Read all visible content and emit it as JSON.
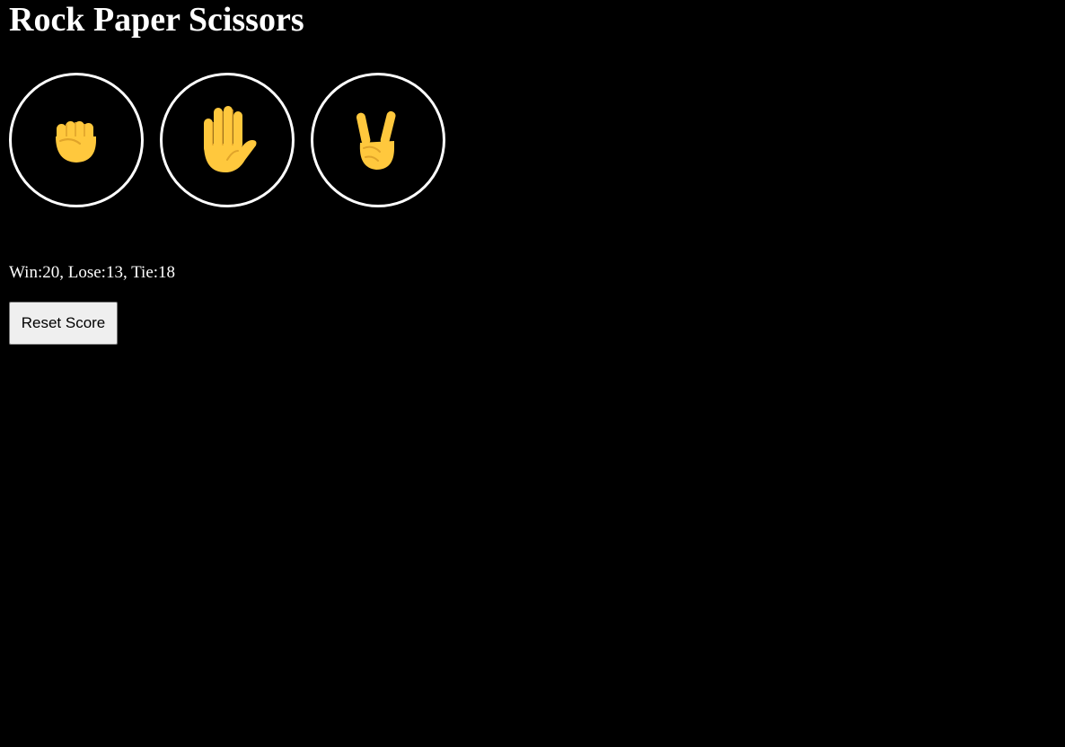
{
  "title": "Rock Paper Scissors",
  "choices": [
    {
      "name": "rock",
      "icon": "raised-fist-icon"
    },
    {
      "name": "paper",
      "icon": "raised-hand-icon"
    },
    {
      "name": "scissors",
      "icon": "victory-hand-icon"
    }
  ],
  "score": {
    "text": "Win:20, Lose:13, Tie:18",
    "win": 20,
    "lose": 13,
    "tie": 18
  },
  "reset_label": "Reset Score",
  "colors": {
    "background": "#000000",
    "text": "#ffffff",
    "circle_border": "#ffffff",
    "hand_fill": "#FFC83D",
    "hand_line": "#E0A42A"
  }
}
